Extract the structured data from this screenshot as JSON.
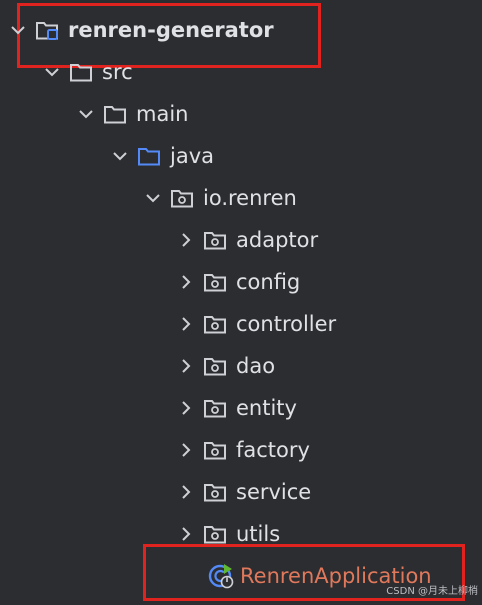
{
  "tree": {
    "root": {
      "label": "renren-generator",
      "expanded": true,
      "icon": "module-folder-icon"
    },
    "src": {
      "label": "src",
      "expanded": true,
      "icon": "folder-icon"
    },
    "main": {
      "label": "main",
      "expanded": true,
      "icon": "folder-icon"
    },
    "java": {
      "label": "java",
      "expanded": true,
      "icon": "source-folder-icon"
    },
    "package": {
      "label": "io.renren",
      "expanded": true,
      "icon": "package-icon"
    },
    "children": [
      {
        "label": "adaptor",
        "expanded": false,
        "icon": "package-icon"
      },
      {
        "label": "config",
        "expanded": false,
        "icon": "package-icon"
      },
      {
        "label": "controller",
        "expanded": false,
        "icon": "package-icon"
      },
      {
        "label": "dao",
        "expanded": false,
        "icon": "package-icon"
      },
      {
        "label": "entity",
        "expanded": false,
        "icon": "package-icon"
      },
      {
        "label": "factory",
        "expanded": false,
        "icon": "package-icon"
      },
      {
        "label": "service",
        "expanded": false,
        "icon": "package-icon"
      },
      {
        "label": "utils",
        "expanded": false,
        "icon": "package-icon"
      }
    ],
    "app": {
      "label": "RenrenApplication",
      "icon": "spring-boot-class-icon"
    }
  },
  "colors": {
    "background": "#2b2d30",
    "text": "#dfe1e5",
    "highlight": "#e0231f",
    "app_text": "#e0795c",
    "source_folder": "#548af7"
  },
  "watermark": "CSDN @月未上柳梢"
}
